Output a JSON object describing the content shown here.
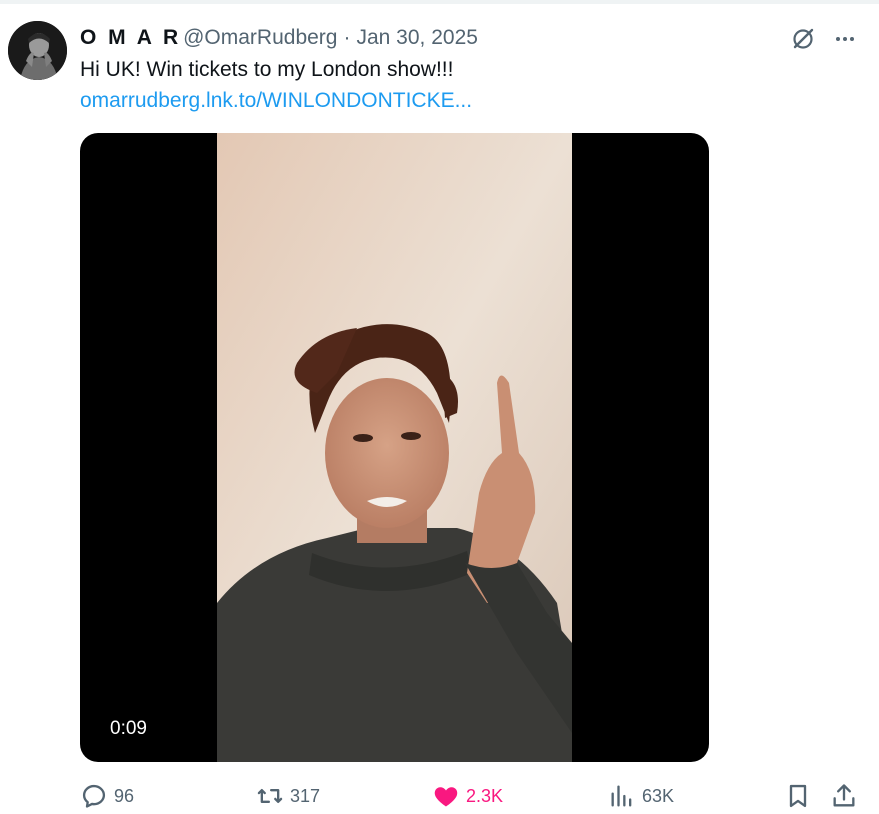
{
  "tweet": {
    "display_name": "O M A R",
    "handle": "@OmarRudberg",
    "separator": "·",
    "date": "Jan 30, 2025",
    "text": "Hi UK! Win tickets to my London show!!!",
    "link": "omarrudberg.lnk.to/WINLONDONTICKE..."
  },
  "media": {
    "type": "video",
    "timecode": "0:09"
  },
  "actions": {
    "replies": "96",
    "reposts": "317",
    "likes": "2.3K",
    "views": "63K"
  },
  "icons": {
    "grok": "grok-icon",
    "more": "more-icon",
    "reply": "reply-icon",
    "repost": "repost-icon",
    "like": "heart-filled-icon",
    "views": "views-icon",
    "bookmark": "bookmark-icon",
    "share": "share-icon"
  },
  "colors": {
    "text": "#0f1419",
    "secondary": "#536471",
    "link": "#1d9bf0",
    "like": "#f91880"
  }
}
